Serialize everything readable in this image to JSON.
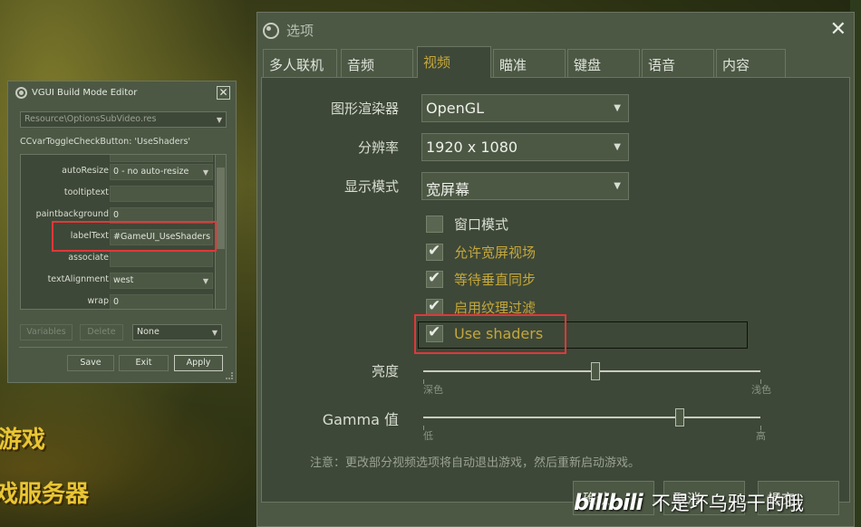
{
  "background": {
    "text_lines": [
      "游戏",
      "戏服务器"
    ]
  },
  "vgui_editor": {
    "title": "VGUI Build Mode Editor",
    "close_glyph": "✕",
    "resource_file": "Resource\\OptionsSubVideo.res",
    "class_line": "CCvarToggleCheckButton: 'UseShaders'",
    "properties": [
      {
        "name": "autoResize",
        "value": "0 - no auto-resize",
        "dropdown": true
      },
      {
        "name": "tooltiptext",
        "value": "",
        "dropdown": false
      },
      {
        "name": "paintbackground",
        "value": "0",
        "dropdown": false
      },
      {
        "name": "labelText",
        "value": "#GameUI_UseShaders",
        "dropdown": false
      },
      {
        "name": "associate",
        "value": "",
        "dropdown": false
      },
      {
        "name": "textAlignment",
        "value": "west",
        "dropdown": true
      },
      {
        "name": "wrap",
        "value": "0",
        "dropdown": false
      }
    ],
    "variables_label": "Variables",
    "delete_label": "Delete",
    "none_select": "None",
    "save_label": "Save",
    "exit_label": "Exit",
    "apply_label": "Apply"
  },
  "options": {
    "title": "选项",
    "close_glyph": "✕",
    "tabs": [
      "多人联机",
      "音频",
      "视频",
      "瞄准",
      "键盘",
      "语音",
      "内容"
    ],
    "selected_tab": "视频",
    "renderer_label": "图形渲染器",
    "renderer_value": "OpenGL",
    "resolution_label": "分辨率",
    "resolution_value": "1920 x 1080",
    "display_mode_label": "显示模式",
    "display_mode_value": "宽屏幕",
    "checkboxes": [
      {
        "label": "窗口模式",
        "checked": false
      },
      {
        "label": "允许宽屏视场",
        "checked": true
      },
      {
        "label": "等待垂直同步",
        "checked": true
      },
      {
        "label": "启用纹理过滤",
        "checked": true
      },
      {
        "label": "Use shaders",
        "checked": true
      }
    ],
    "brightness_label": "亮度",
    "brightness_min": "深色",
    "brightness_max": "浅色",
    "brightness_level": 0.51,
    "gamma_label": "Gamma 值",
    "gamma_min": "低",
    "gamma_max": "高",
    "gamma_level": 0.76,
    "note": "注意：更改部分视频选项将自动退出游戏，然后重新启动游戏。",
    "ok_label": "确认",
    "cancel_label": "取消",
    "apply_label": "提交"
  },
  "watermark": {
    "logo": "bilibili",
    "author": "不是坏乌鸦干的哦"
  },
  "colors": {
    "panel": "#4c5844",
    "panel_dark": "#3e4838",
    "accent_text": "#c4a73c",
    "highlight_box": "#e0383a"
  }
}
